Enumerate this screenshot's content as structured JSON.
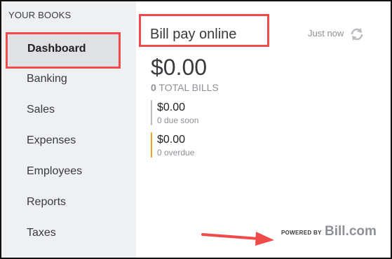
{
  "sidebar": {
    "heading": "YOUR BOOKS",
    "items": [
      {
        "label": "Dashboard",
        "active": true
      },
      {
        "label": "Banking"
      },
      {
        "label": "Sales"
      },
      {
        "label": "Expenses"
      },
      {
        "label": "Employees"
      },
      {
        "label": "Reports"
      },
      {
        "label": "Taxes"
      }
    ]
  },
  "widget": {
    "title": "Bill pay online",
    "updated": "Just now",
    "total_amount": "$0.00",
    "total_count": "0",
    "total_label": "TOTAL BILLS",
    "due_soon": {
      "amount": "$0.00",
      "label": "0 due soon"
    },
    "overdue": {
      "amount": "$0.00",
      "label": "0 overdue"
    },
    "powered_by": "POWERED BY",
    "logo": "Bill.com"
  },
  "colors": {
    "highlight": "#ef4b4b",
    "due_soon_bar": "#b9bcc0",
    "overdue_bar": "#f2a22a",
    "sidebar_bg": "#eef0f2"
  },
  "icons": [
    "refresh-icon",
    "annotation-arrow"
  ]
}
